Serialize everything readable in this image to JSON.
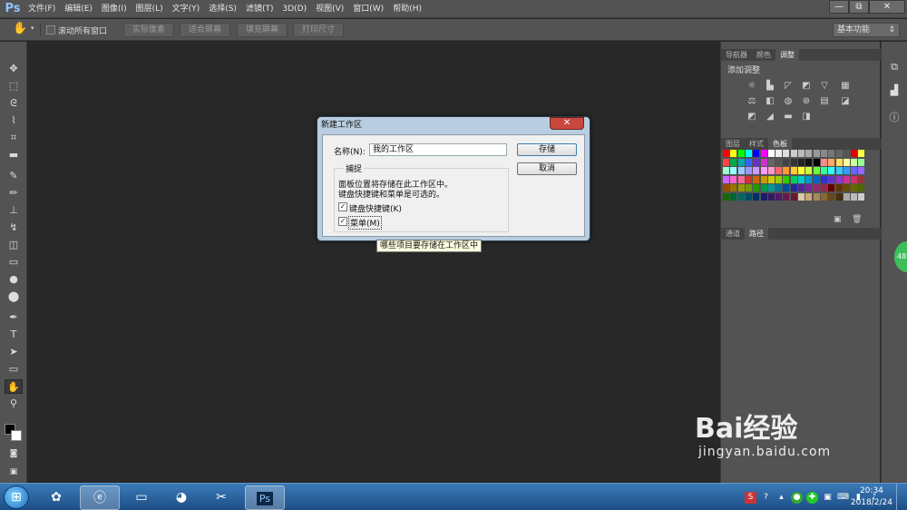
{
  "app": {
    "logo": "Ps"
  },
  "menu": [
    "文件(F)",
    "编辑(E)",
    "图像(I)",
    "图层(L)",
    "文字(Y)",
    "选择(S)",
    "滤镜(T)",
    "3D(D)",
    "视图(V)",
    "窗口(W)",
    "帮助(H)"
  ],
  "window_controls": {
    "minimize": "—",
    "restore": "⧉",
    "close": "✕"
  },
  "options": {
    "scroll_all_label": "滚动所有窗口",
    "buttons": [
      "实际像素",
      "适合屏幕",
      "填充屏幕",
      "打印尺寸"
    ],
    "workspace": "基本功能"
  },
  "panels": {
    "top_tabs": [
      "导航器",
      "颜色",
      "调整"
    ],
    "adjust_title": "添加调整",
    "mid_tabs": [
      "图层",
      "样式",
      "色板"
    ],
    "bottom_tabs": [
      "通道",
      "路径"
    ]
  },
  "dialog": {
    "title": "新建工作区",
    "close": "✕",
    "name_label": "名称(N):",
    "name_value": "我的工作区",
    "save": "存储",
    "cancel": "取消",
    "group": "捕捉",
    "desc_line1": "面板位置将存储在此工作区中。",
    "desc_line2": "键盘快捷键和菜单是可选的。",
    "cb_shortcuts": "键盘快捷键(K)",
    "cb_menus": "菜单(M)",
    "tooltip": "哪些项目要存储在工作区中"
  },
  "badge": "48",
  "watermark": {
    "main": "Bai经验",
    "sub": "jingyan.baidu.com"
  },
  "clock": {
    "time": "20:34",
    "date": "2018/2/24"
  }
}
